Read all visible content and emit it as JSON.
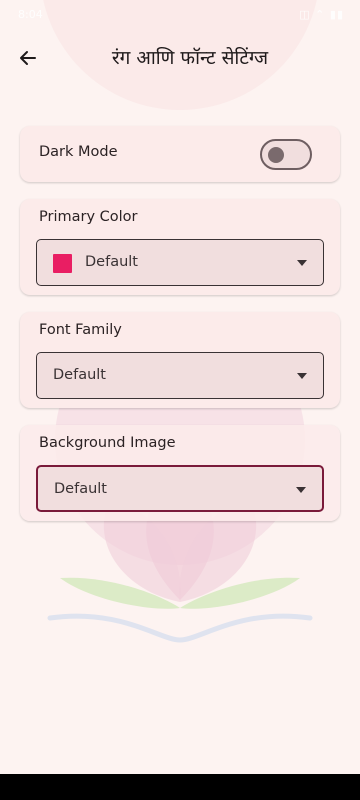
{
  "status_bar": {
    "time": "8:04",
    "icons": "◫ ⌃ ▮▮"
  },
  "app_bar": {
    "title": "रंग आणि फॉन्ट सेटिंग्ज"
  },
  "settings": {
    "dark_mode": {
      "label": "Dark Mode",
      "enabled": false
    },
    "primary_color": {
      "label": "Primary Color",
      "value": "Default",
      "swatch_color": "#e91e63"
    },
    "font_family": {
      "label": "Font Family",
      "value": "Default"
    },
    "background_image": {
      "label": "Background Image",
      "value": "Default"
    }
  },
  "colors": {
    "background": "#fdf3f1",
    "card": "#fcebea",
    "field": "#f1dede",
    "focused_border": "#7a1a3a"
  }
}
